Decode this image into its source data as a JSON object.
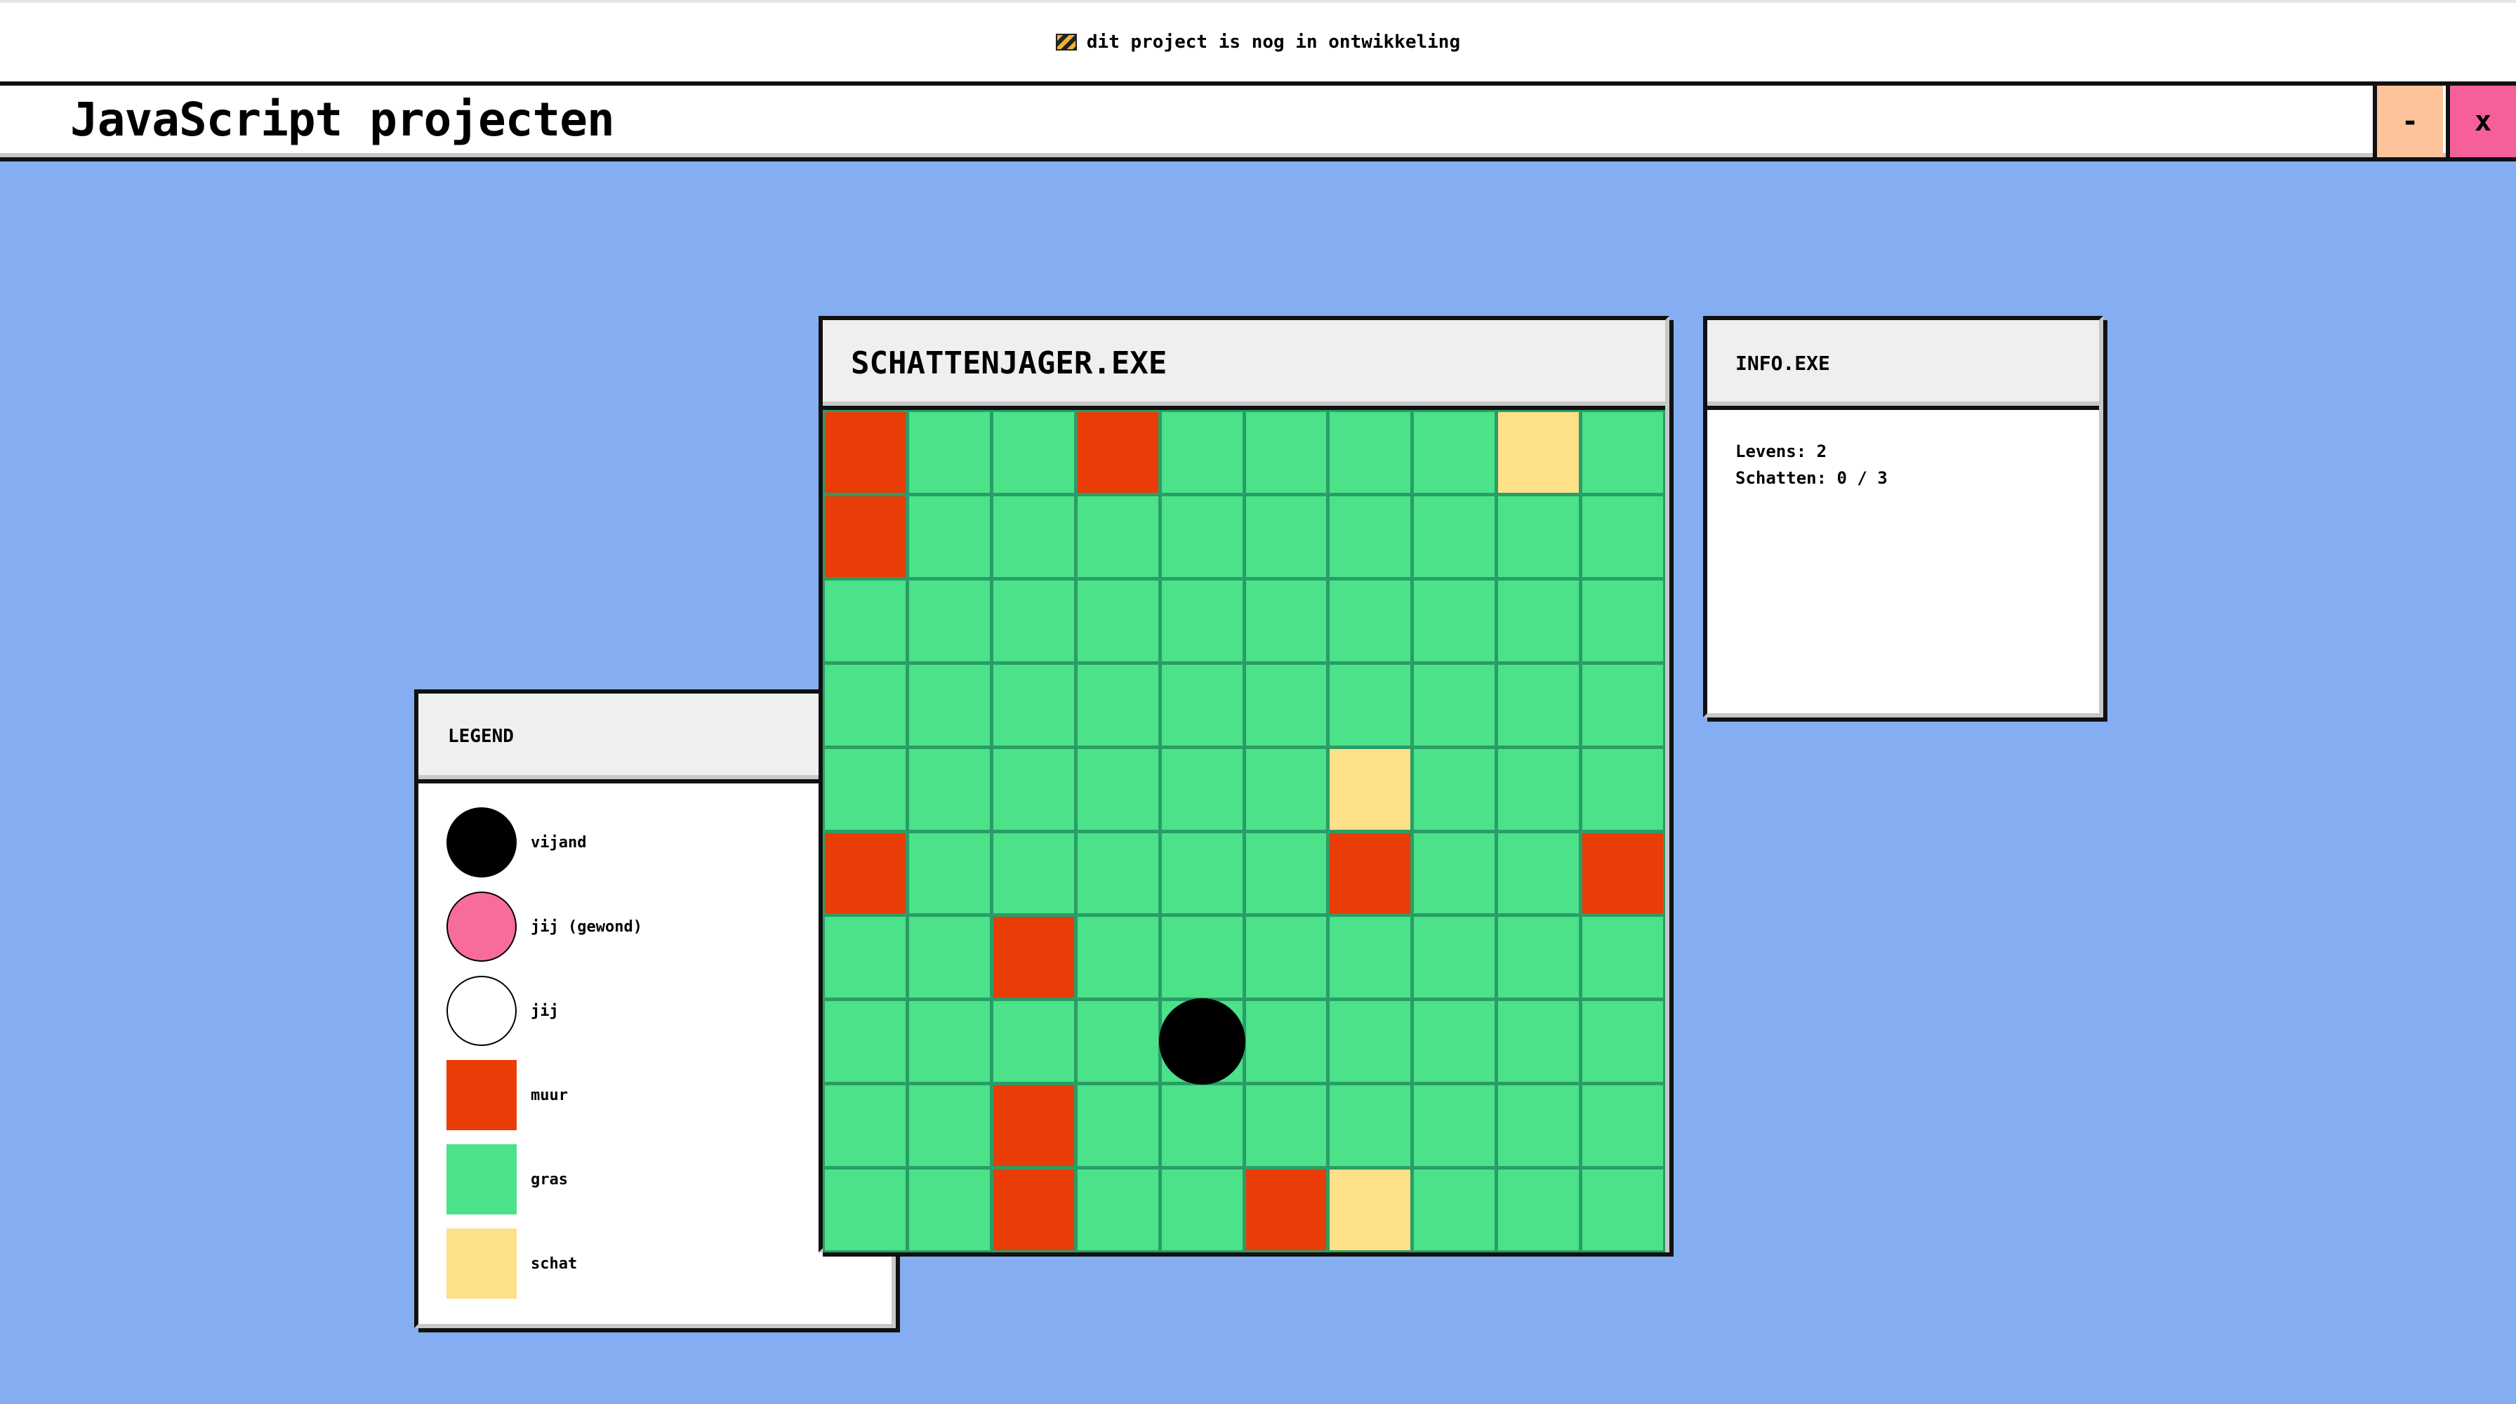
{
  "notice": {
    "text": "dit project is nog in ontwikkeling",
    "icon": "construction-sign-icon"
  },
  "titlebar": {
    "title": "JavaScript projecten",
    "minimize_label": "-",
    "close_label": "x"
  },
  "legend": {
    "title": "LEGEND",
    "items": [
      {
        "label": "vijand",
        "shape": "circle",
        "color": "#000000"
      },
      {
        "label": "jij (gewond)",
        "shape": "circle",
        "color": "#f86c9c"
      },
      {
        "label": "jij",
        "shape": "circle",
        "color": "#ffffff"
      },
      {
        "label": "muur",
        "shape": "square",
        "color": "#ea3c06"
      },
      {
        "label": "gras",
        "shape": "square",
        "color": "#4be28a"
      },
      {
        "label": "schat",
        "shape": "square",
        "color": "#fde087"
      }
    ]
  },
  "game": {
    "title": "SCHATTENJAGER.EXE",
    "grid": [
      [
        "muur",
        "gras",
        "gras",
        "muur",
        "gras",
        "gras",
        "gras",
        "gras",
        "schat",
        "gras"
      ],
      [
        "muur",
        "gras",
        "gras",
        "gras",
        "gras",
        "gras",
        "gras",
        "gras",
        "gras",
        "gras"
      ],
      [
        "gras",
        "gras",
        "gras",
        "gras",
        "gras",
        "gras",
        "gras",
        "gras",
        "gras",
        "gras"
      ],
      [
        "gras",
        "gras",
        "gras",
        "gras",
        "gras",
        "gras",
        "gras",
        "gras",
        "gras",
        "gras"
      ],
      [
        "gras",
        "gras",
        "gras",
        "gras",
        "gras",
        "gras",
        "schat",
        "gras",
        "gras",
        "gras"
      ],
      [
        "muur",
        "gras",
        "gras",
        "gras",
        "gras",
        "gras",
        "muur",
        "gras",
        "gras",
        "muur"
      ],
      [
        "gras",
        "gras",
        "muur",
        "gras",
        "gras",
        "gras",
        "gras",
        "gras",
        "gras",
        "gras"
      ],
      [
        "gras",
        "gras",
        "gras",
        "gras",
        "gras",
        "gras",
        "gras",
        "gras",
        "gras",
        "gras"
      ],
      [
        "gras",
        "gras",
        "muur",
        "gras",
        "gras",
        "gras",
        "gras",
        "gras",
        "gras",
        "gras"
      ],
      [
        "gras",
        "gras",
        "muur",
        "gras",
        "gras",
        "muur",
        "schat",
        "gras",
        "gras",
        "gras"
      ]
    ],
    "tokens": [
      {
        "type": "vijand",
        "row": 7,
        "col": 4
      }
    ]
  },
  "info": {
    "title": "INFO.EXE",
    "levens": "Levens: 2",
    "schatten": "Schatten: 0 / 3"
  }
}
